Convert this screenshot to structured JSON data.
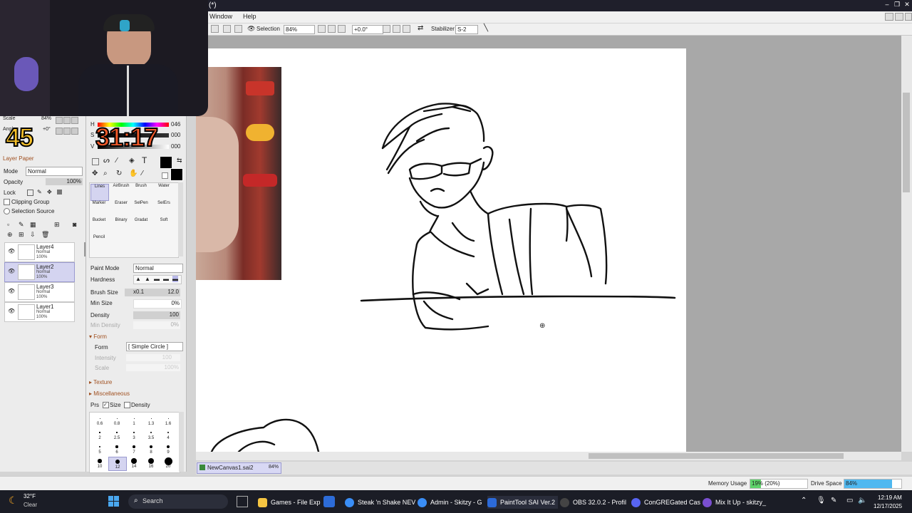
{
  "window": {
    "title": "(*)",
    "controls": [
      "–",
      "❐",
      "✕"
    ]
  },
  "menu": {
    "items": [
      "Window",
      "Help"
    ]
  },
  "toolbar": {
    "selection_label": "Selection",
    "zoom": "84%",
    "rotation": "+0.0°",
    "stabilizer_label": "Stabilizer",
    "stabilizer_value": "S-2"
  },
  "overlay": {
    "counter": "45",
    "timer": "31:17"
  },
  "navigator": {
    "scale_label": "Scale",
    "scale_value": "84%",
    "angle_label": "Angl",
    "angle_value": "+0°"
  },
  "color": {
    "h_label": "H",
    "h_value": "046",
    "s_label": "S",
    "s_value": "000",
    "v_label": "V",
    "v_value": "000",
    "text_tool": "T"
  },
  "layer_panel": {
    "title": "Layer Paper",
    "mode_label": "Mode",
    "mode_value": "Normal",
    "opacity_label": "Opacity",
    "opacity_value": "100%",
    "lock_label": "Lock",
    "clipping_group": "Clipping Group",
    "selection_source": "Selection Source",
    "layers": [
      {
        "name": "Layer4",
        "mode": "Normal",
        "opacity": "100%"
      },
      {
        "name": "Layer2",
        "mode": "Normal",
        "opacity": "100%"
      },
      {
        "name": "Layer3",
        "mode": "Normal",
        "opacity": "100%"
      },
      {
        "name": "Layer1",
        "mode": "Normal",
        "opacity": "100%"
      }
    ]
  },
  "brushes": {
    "items": [
      "Lines",
      "AirBrush",
      "Brush",
      "Water",
      "Marker",
      "Eraser",
      "SelPen",
      "SelErs",
      "Bucket",
      "Binary",
      "Gradat",
      "Soft",
      "Pencil"
    ]
  },
  "tool_settings": {
    "paint_mode_label": "Paint Mode",
    "paint_mode_value": "Normal",
    "hardness_label": "Hardness",
    "brush_size_label": "Brush Size",
    "brush_size_mult": "x0.1",
    "brush_size_value": "12.0",
    "min_size_label": "Min Size",
    "min_size_value": "0%",
    "density_label": "Density",
    "density_value": "100",
    "min_density_label": "Min Density",
    "min_density_value": "0%",
    "form_section": "Form",
    "form_label": "Form",
    "form_value": "[ Simple Circle ]",
    "intensity_label": "Intensity",
    "intensity_value": "100",
    "scale_label": "Scale",
    "scale_value": "100%",
    "texture_section": "Texture",
    "misc_section": "Miscellaneous",
    "prs_label": "Prs",
    "size_check": "Size",
    "density_check": "Density",
    "size_presets": [
      "0.6",
      "0.8",
      "1",
      "1.3",
      "1.6",
      "2",
      "2.5",
      "3",
      "3.5",
      "4",
      "5",
      "6",
      "7",
      "8",
      "9",
      "10",
      "12",
      "14",
      "16",
      "20"
    ]
  },
  "document_tab": {
    "name": "NewCanvas1.sai2",
    "zoom": "84%"
  },
  "status": {
    "memory_label": "Memory Usage",
    "memory_value": "19% (20%)",
    "memory_fraction": 0.19,
    "drive_label": "Drive Space",
    "drive_value": "84%",
    "drive_fraction": 0.84
  },
  "taskbar": {
    "weather_temp": "32°F",
    "weather_cond": "Clear",
    "search": "Search",
    "apps": [
      {
        "label": "Games - File Exp",
        "color": "#f5c542"
      },
      {
        "label": "Steak 'n Shake NEV",
        "color": "#3a8ef6"
      },
      {
        "label": "Admin - Skitzy - G",
        "color": "#3a8ef6"
      },
      {
        "label": "PaintTool SAI Ver.2",
        "color": "#2c6ad8"
      },
      {
        "label": "OBS 32.0.2 - Profil",
        "color": "#444"
      },
      {
        "label": "ConGREGated Cas",
        "color": "#5865f2"
      },
      {
        "label": "Mix It Up - skitzy_",
        "color": "#7a4fd0"
      }
    ],
    "time": "12:19 AM",
    "date": "12/17/2025"
  }
}
